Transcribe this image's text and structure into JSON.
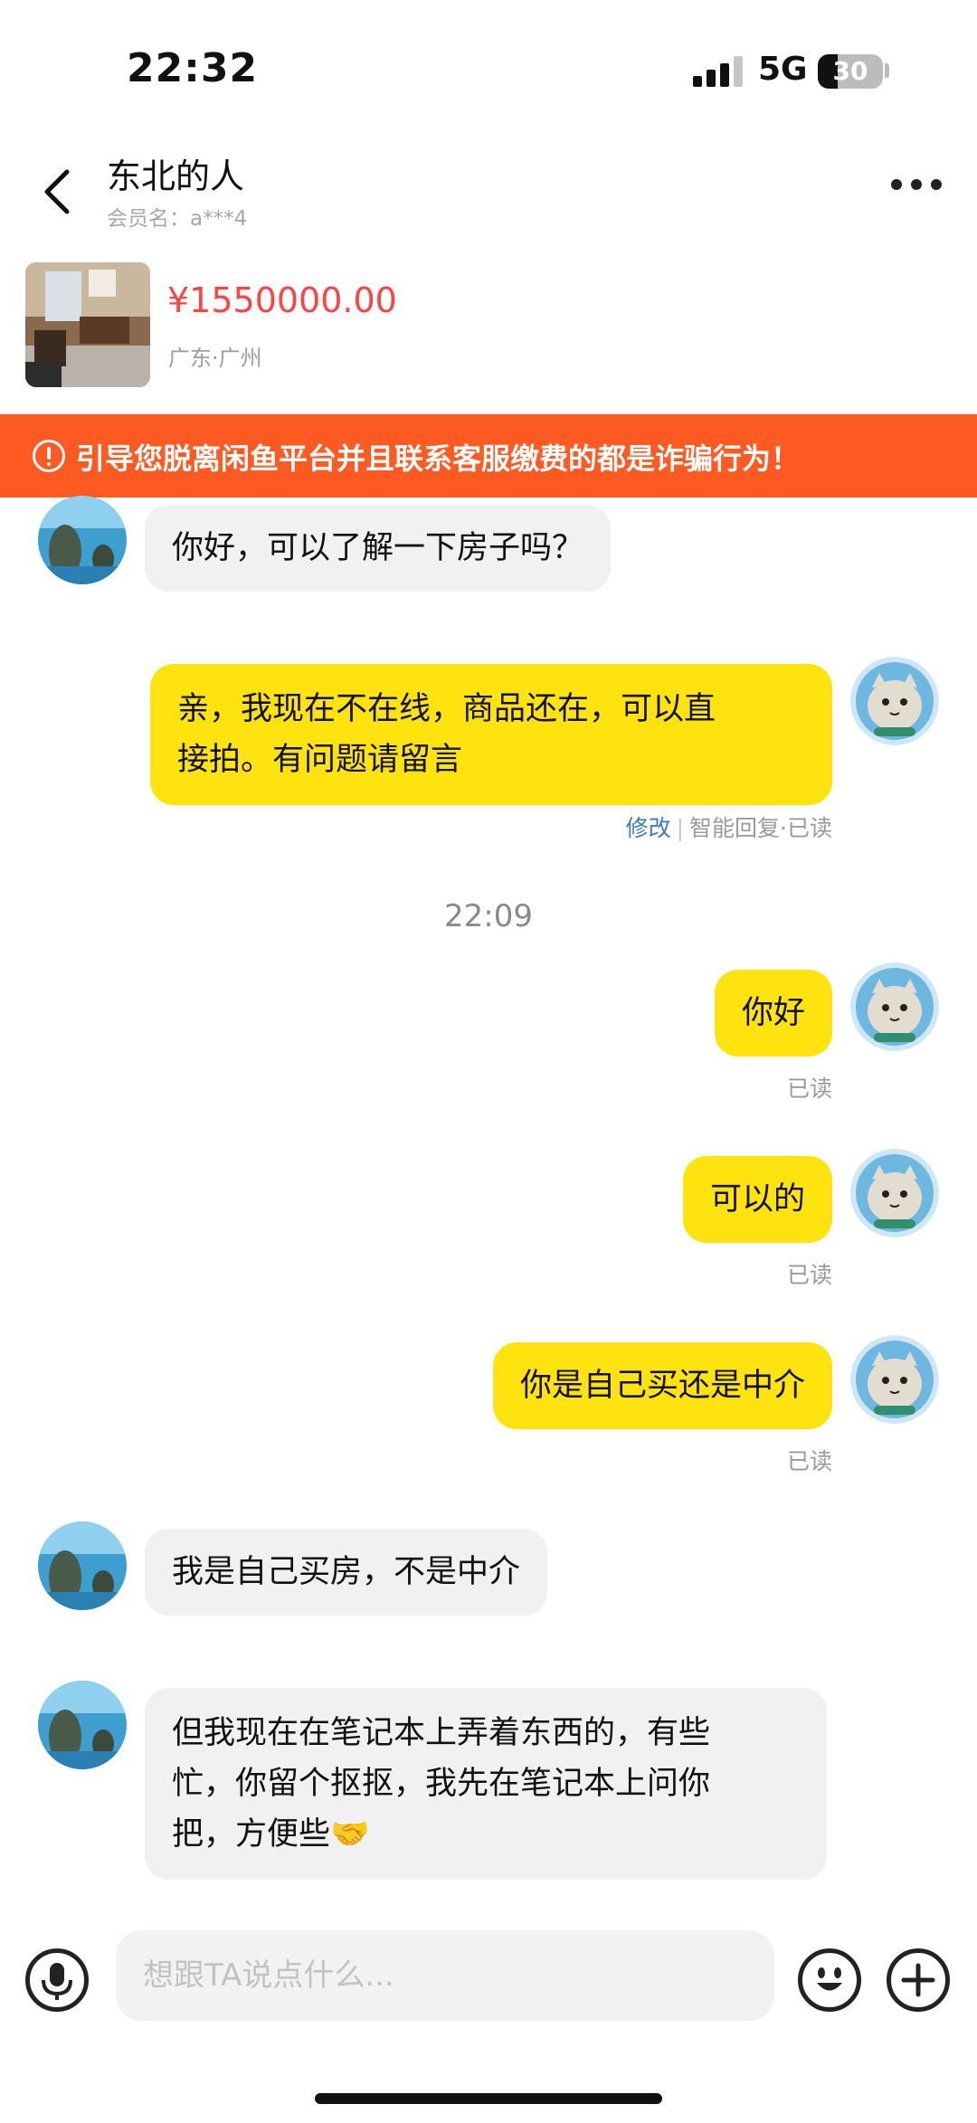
{
  "status_bar": {
    "time": "22:32",
    "network": "5G",
    "battery": "30",
    "battery_level": 0.3
  },
  "header": {
    "title": "东北的人",
    "subtitle": "会员名：a***4"
  },
  "product": {
    "price": "¥1550000.00",
    "location": "广东·广州"
  },
  "warning": {
    "text": "引导您脱离闲鱼平台并且联系客服缴费的都是诈骗行为！"
  },
  "messages": [
    {
      "from": "them",
      "text": "你好，可以了解一下房子吗？"
    },
    {
      "from": "me",
      "lines": [
        "亲，我现在不在线，商品还在，可以直",
        "接拍。有问题请留言"
      ],
      "edit_label": "修改",
      "auto_reply_label": "智能回复",
      "status": "已读"
    },
    {
      "from": "me",
      "text": "你好",
      "status": "已读"
    },
    {
      "from": "me",
      "text": "可以的",
      "status": "已读"
    },
    {
      "from": "me",
      "text": "你是自己买还是中介",
      "status": "已读"
    },
    {
      "from": "them",
      "text": "我是自己买房，不是中介"
    },
    {
      "from": "them",
      "lines": [
        "但我现在在笔记本上弄着东西的，有些",
        "忙，你留个抠抠，我先在笔记本上问你",
        "把，方便些🤝"
      ]
    }
  ],
  "time_divider": "22:09",
  "input": {
    "placeholder": "想跟TA说点什么..."
  },
  "colors": {
    "accent_yellow": "#ffe30f",
    "warning_orange": "#ff5a22",
    "price_red": "#ff4242",
    "link_blue": "#3f79c2"
  }
}
